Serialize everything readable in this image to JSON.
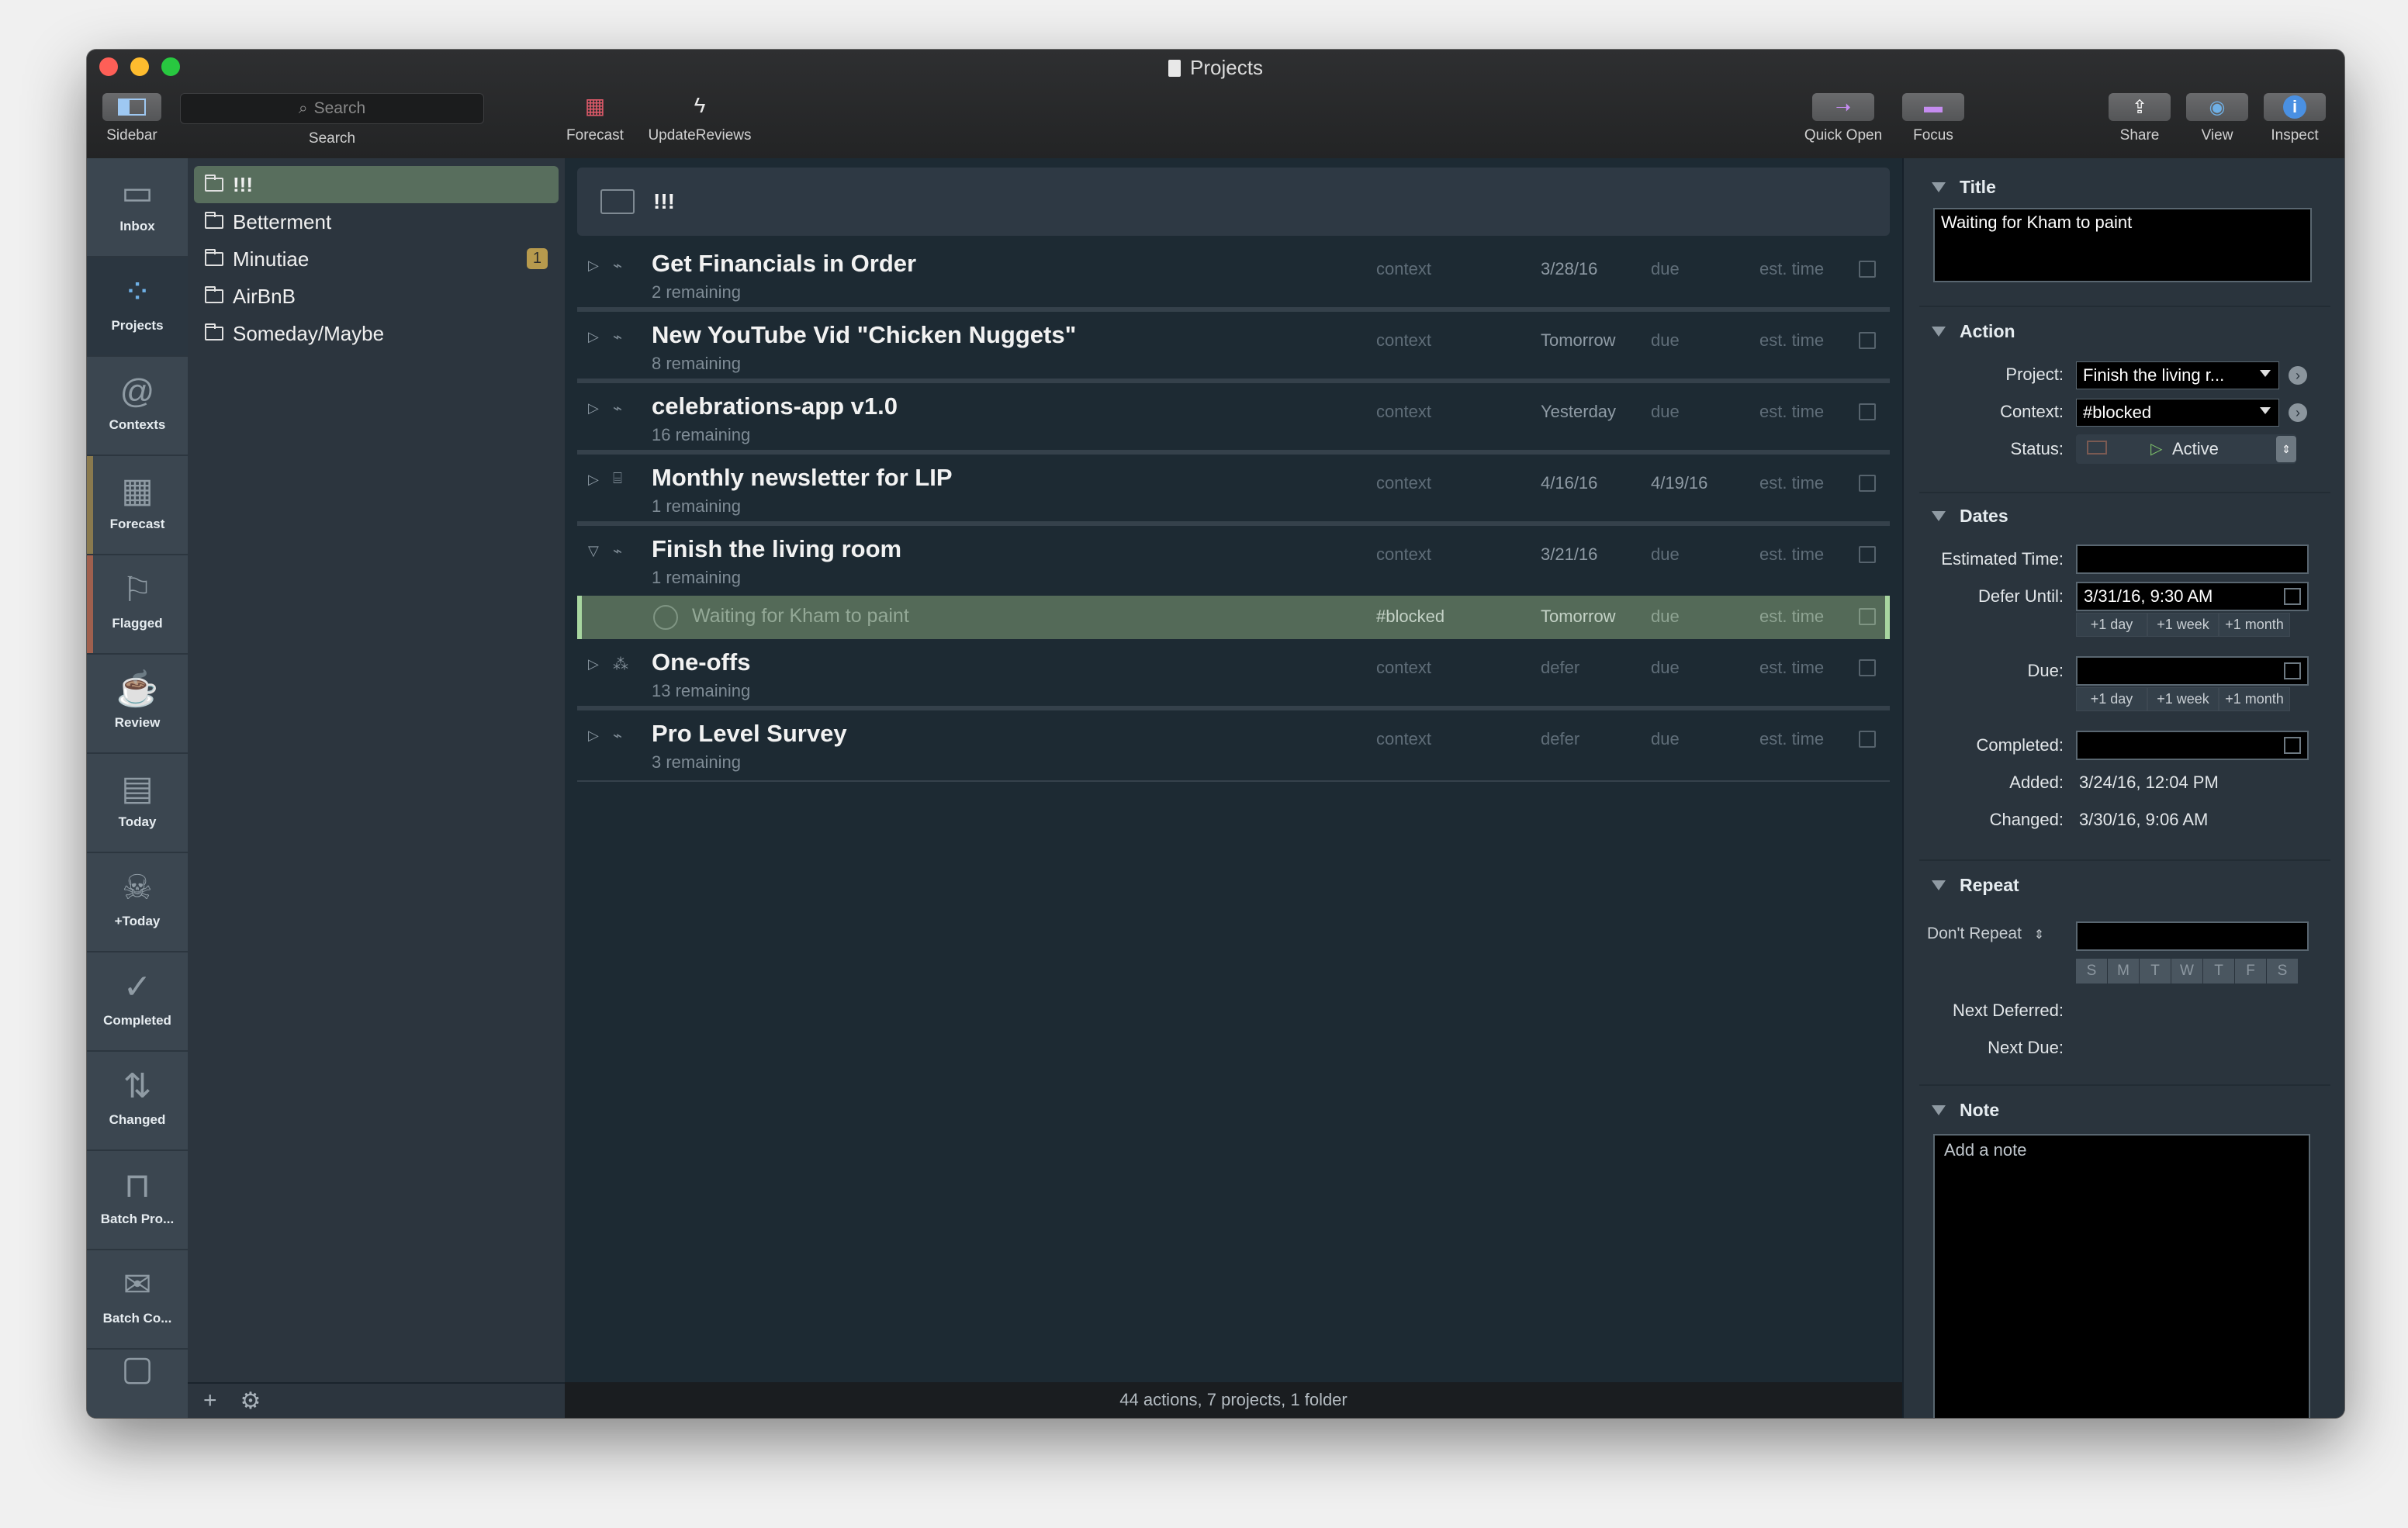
{
  "window": {
    "title": "Projects"
  },
  "toolbar": {
    "sidebar": "Sidebar",
    "search_placeholder": "Search",
    "search": "Search",
    "forecast": "Forecast",
    "update_reviews": "UpdateReviews",
    "quick_open": "Quick Open",
    "focus": "Focus",
    "share": "Share",
    "view": "View",
    "inspect": "Inspect"
  },
  "perspectives": [
    {
      "label": "Inbox",
      "icon": "inbox-icon"
    },
    {
      "label": "Projects",
      "icon": "projects-icon"
    },
    {
      "label": "Contexts",
      "icon": "at-sign-icon"
    },
    {
      "label": "Forecast",
      "icon": "forecast-grid-icon"
    },
    {
      "label": "Flagged",
      "icon": "flag-icon"
    },
    {
      "label": "Review",
      "icon": "coffee-cup-icon"
    },
    {
      "label": "Today",
      "icon": "calendar-icon"
    },
    {
      "label": "+Today",
      "icon": "skull-icon"
    },
    {
      "label": "Completed",
      "icon": "checkmark-circle-icon"
    },
    {
      "label": "Changed",
      "icon": "up-down-arrows-icon"
    },
    {
      "label": "Batch Pro...",
      "icon": "bench-icon"
    },
    {
      "label": "Batch Co...",
      "icon": "envelope-icon"
    }
  ],
  "colors": {
    "forecast_stripe": "#8a7a4e",
    "flagged_stripe": "#a0604e",
    "selected": "#586e5d",
    "accent": "#6fb0e6"
  },
  "sidebar": {
    "items": [
      {
        "label": "!!!"
      },
      {
        "label": "Betterment"
      },
      {
        "label": "Minutiae",
        "badge": "1"
      },
      {
        "label": "AirBnB"
      },
      {
        "label": "Someday/Maybe"
      }
    ],
    "footer_add": "+",
    "footer_gear": "⚙"
  },
  "main": {
    "folder_title": "!!!",
    "projects": [
      {
        "title": "Get Financials in Order",
        "remaining": "2 remaining",
        "context": "context",
        "defer": "3/28/16",
        "due": "due",
        "est": "est. time"
      },
      {
        "title": "New YouTube Vid \"Chicken Nuggets\"",
        "remaining": "8 remaining",
        "context": "context",
        "defer": "Tomorrow",
        "due": "due",
        "est": "est. time"
      },
      {
        "title": "celebrations-app v1.0",
        "remaining": "16 remaining",
        "context": "context",
        "defer": "Yesterday",
        "due": "due",
        "est": "est. time"
      },
      {
        "title": "Monthly newsletter for LIP",
        "remaining": "1 remaining",
        "context": "context",
        "defer": "4/16/16",
        "due": "4/19/16",
        "est": "est. time"
      },
      {
        "title": "Finish the living room",
        "remaining": "1 remaining",
        "context": "context",
        "defer": "3/21/16",
        "due": "due",
        "est": "est. time"
      },
      {
        "title": "One-offs",
        "remaining": "13 remaining",
        "context": "context",
        "defer": "defer",
        "due": "due",
        "est": "est. time"
      },
      {
        "title": "Pro Level Survey",
        "remaining": "3 remaining",
        "context": "context",
        "defer": "defer",
        "due": "due",
        "est": "est. time"
      }
    ],
    "action": {
      "title": "Waiting for Kham to paint",
      "context": "#blocked",
      "defer": "Tomorrow",
      "due": "due",
      "est": "est. time"
    },
    "footer": "44 actions, 7 projects, 1 folder"
  },
  "inspector": {
    "title_section": "Title",
    "title_value": "Waiting for Kham to paint",
    "action_section": "Action",
    "project_label": "Project:",
    "project_value": "Finish the living r...",
    "context_label": "Context:",
    "context_value": "#blocked",
    "status_label": "Status:",
    "status_value": "Active",
    "dates_section": "Dates",
    "estimated_label": "Estimated Time:",
    "defer_label": "Defer Until:",
    "defer_value": "3/31/16, 9:30 AM",
    "plus_day": "+1 day",
    "plus_week": "+1 week",
    "plus_month": "+1 month",
    "due_label": "Due:",
    "completed_label": "Completed:",
    "added_label": "Added:",
    "added_value": "3/24/16, 12:04 PM",
    "changed_label": "Changed:",
    "changed_value": "3/30/16, 9:06 AM",
    "repeat_section": "Repeat",
    "repeat_value": "Don't Repeat",
    "weekdays": [
      "S",
      "M",
      "T",
      "W",
      "T",
      "F",
      "S"
    ],
    "next_deferred_label": "Next Deferred:",
    "next_due_label": "Next Due:",
    "note_section": "Note",
    "note_placeholder": "Add a note"
  }
}
